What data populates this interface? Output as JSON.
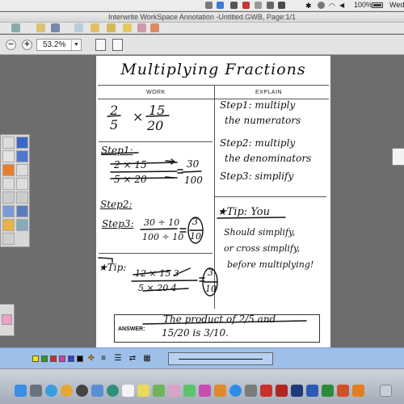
{
  "menubar": {
    "battery_pct": "100%",
    "clock_fragment": "Wed"
  },
  "window": {
    "title": "Interwrite WorkSpace Annotation -Untitled.GWB, Page:1/1"
  },
  "zoom": {
    "value": "53.2%",
    "minus": "−",
    "plus": "+",
    "dropdown_glyph": "▼"
  },
  "worksheet": {
    "title": "Multiplying Fractions",
    "col_work": "WORK",
    "col_explain": "EXPLAIN",
    "answer_label": "ANSWER:",
    "handwriting": {
      "problem_a_num": "2",
      "problem_a_den": "5",
      "times": "×",
      "problem_b_num": "15",
      "problem_b_den": "20",
      "step1_label": "Step1:",
      "step1_line1_num": "2 × 15",
      "step1_line2_den": "5 × 20",
      "step1_result_num": "30",
      "step1_result_den": "100",
      "step2_label": "Step2:",
      "step3_label": "Step3:",
      "step3_num": "30 ÷ 10",
      "step3_den": "100 ÷ 10",
      "step3_result_num": "3",
      "step3_result_den": "10",
      "tip_label": "★Tip:",
      "tip_num": "12 × 15 3",
      "tip_den": "5 × 20 4",
      "tip_result_num": "3",
      "tip_result_den": "10",
      "explain_step1_a": "Step1: multiply",
      "explain_step1_b": "the numerators",
      "explain_step2_a": "Step2: multiply",
      "explain_step2_b": "the denominators",
      "explain_step3": "Step3: simplify",
      "explain_tip_a": "★Tip: You",
      "explain_tip_b": "Should simplify,",
      "explain_tip_c": "or cross simplify,",
      "explain_tip_d": "before multiplying!",
      "answer_a": "The product of 2/5 and",
      "answer_b": "15/20 is 3/10."
    }
  },
  "colors": {
    "annotation_bar": "#9ebfe8",
    "swatches": [
      "#f2e600",
      "#2d9a2d",
      "#d42a2a",
      "#d43ea8",
      "#2d42d8",
      "#000000"
    ],
    "canvas_bg": "#6d6d6d"
  },
  "icons": {
    "status_menu": [
      "dropbox-icon",
      "app-icon",
      "bluetooth-icon",
      "time-machine-icon",
      "wifi-icon",
      "volume-icon",
      "battery-icon"
    ],
    "dock_apps": [
      "finder-icon",
      "launchpad-icon",
      "safari-icon",
      "chrome-icon",
      "clock-icon",
      "mail-icon",
      "contacts-icon",
      "calendar-icon",
      "notes-icon",
      "maps-icon",
      "photos-icon",
      "messages-icon",
      "itunes-icon",
      "ibooks-icon",
      "appstore-icon",
      "preferences-icon",
      "acrobat-icon",
      "flash-icon",
      "photoshop-icon",
      "word-icon",
      "excel-icon",
      "powerpoint-icon",
      "interwrite-icon",
      "trash-icon"
    ]
  }
}
